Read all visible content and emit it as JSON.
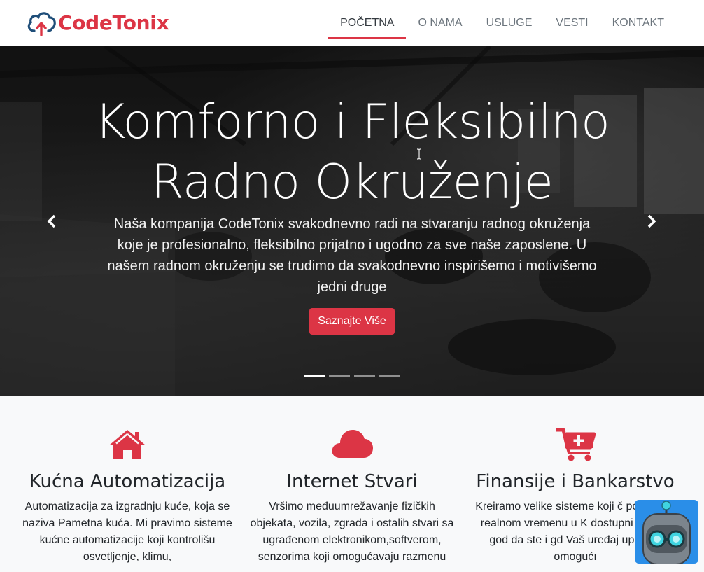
{
  "brand": {
    "name": "CodeTonix",
    "color": "#dc3545"
  },
  "nav": {
    "items": [
      {
        "label": "POČETNA",
        "active": true
      },
      {
        "label": "O NAMA",
        "active": false
      },
      {
        "label": "USLUGE",
        "active": false
      },
      {
        "label": "VESTI",
        "active": false
      },
      {
        "label": "KONTAKT",
        "active": false
      }
    ]
  },
  "hero": {
    "title_line1": "Komforno i Fleksibilno",
    "title_line2": "Radno Okruženje",
    "text": "Naša kompanija CodeTonix svakodnevno radi na stvaranju radnog okruženja koje je profesionalno, fleksibilno prijatno i ugodno za sve naše zaposlene. U našem radnom okruženju se trudimo da svakodnevno inspirišemo i motivišemo jedni druge",
    "button_label": "Saznajte Više",
    "prev_icon": "chevron-left-icon",
    "next_icon": "chevron-right-icon",
    "slide_count": 4,
    "active_slide": 1
  },
  "features": [
    {
      "icon": "home-icon",
      "title": "Kućna Automatizacija",
      "text": "Automatizacija za izgradnju kuće, koja se naziva Pametna kuća. Mi pravimo sisteme kućne automatizacije koji kontrolišu osvetljenje, klimu,"
    },
    {
      "icon": "cloud-icon",
      "title": "Internet Stvari",
      "text": "Vršimo međuumrežavanje fizičkih objekata, vozila, zgrada i ostalih stvari sa ugrađenom elektronikom,softverom, senzorima koji omogućavaju razmenu"
    },
    {
      "icon": "cart-plus-icon",
      "title": "Finansije i Bankarstvo",
      "text": "Kreiramo velike sisteme koji č podatke u realnom vremenu u K dostupni su gde god da ste i gd Vaš uređaj upaljen, omogućı"
    }
  ],
  "colors": {
    "accent": "#dc3545",
    "bot_bg": "#2a8ee8"
  }
}
